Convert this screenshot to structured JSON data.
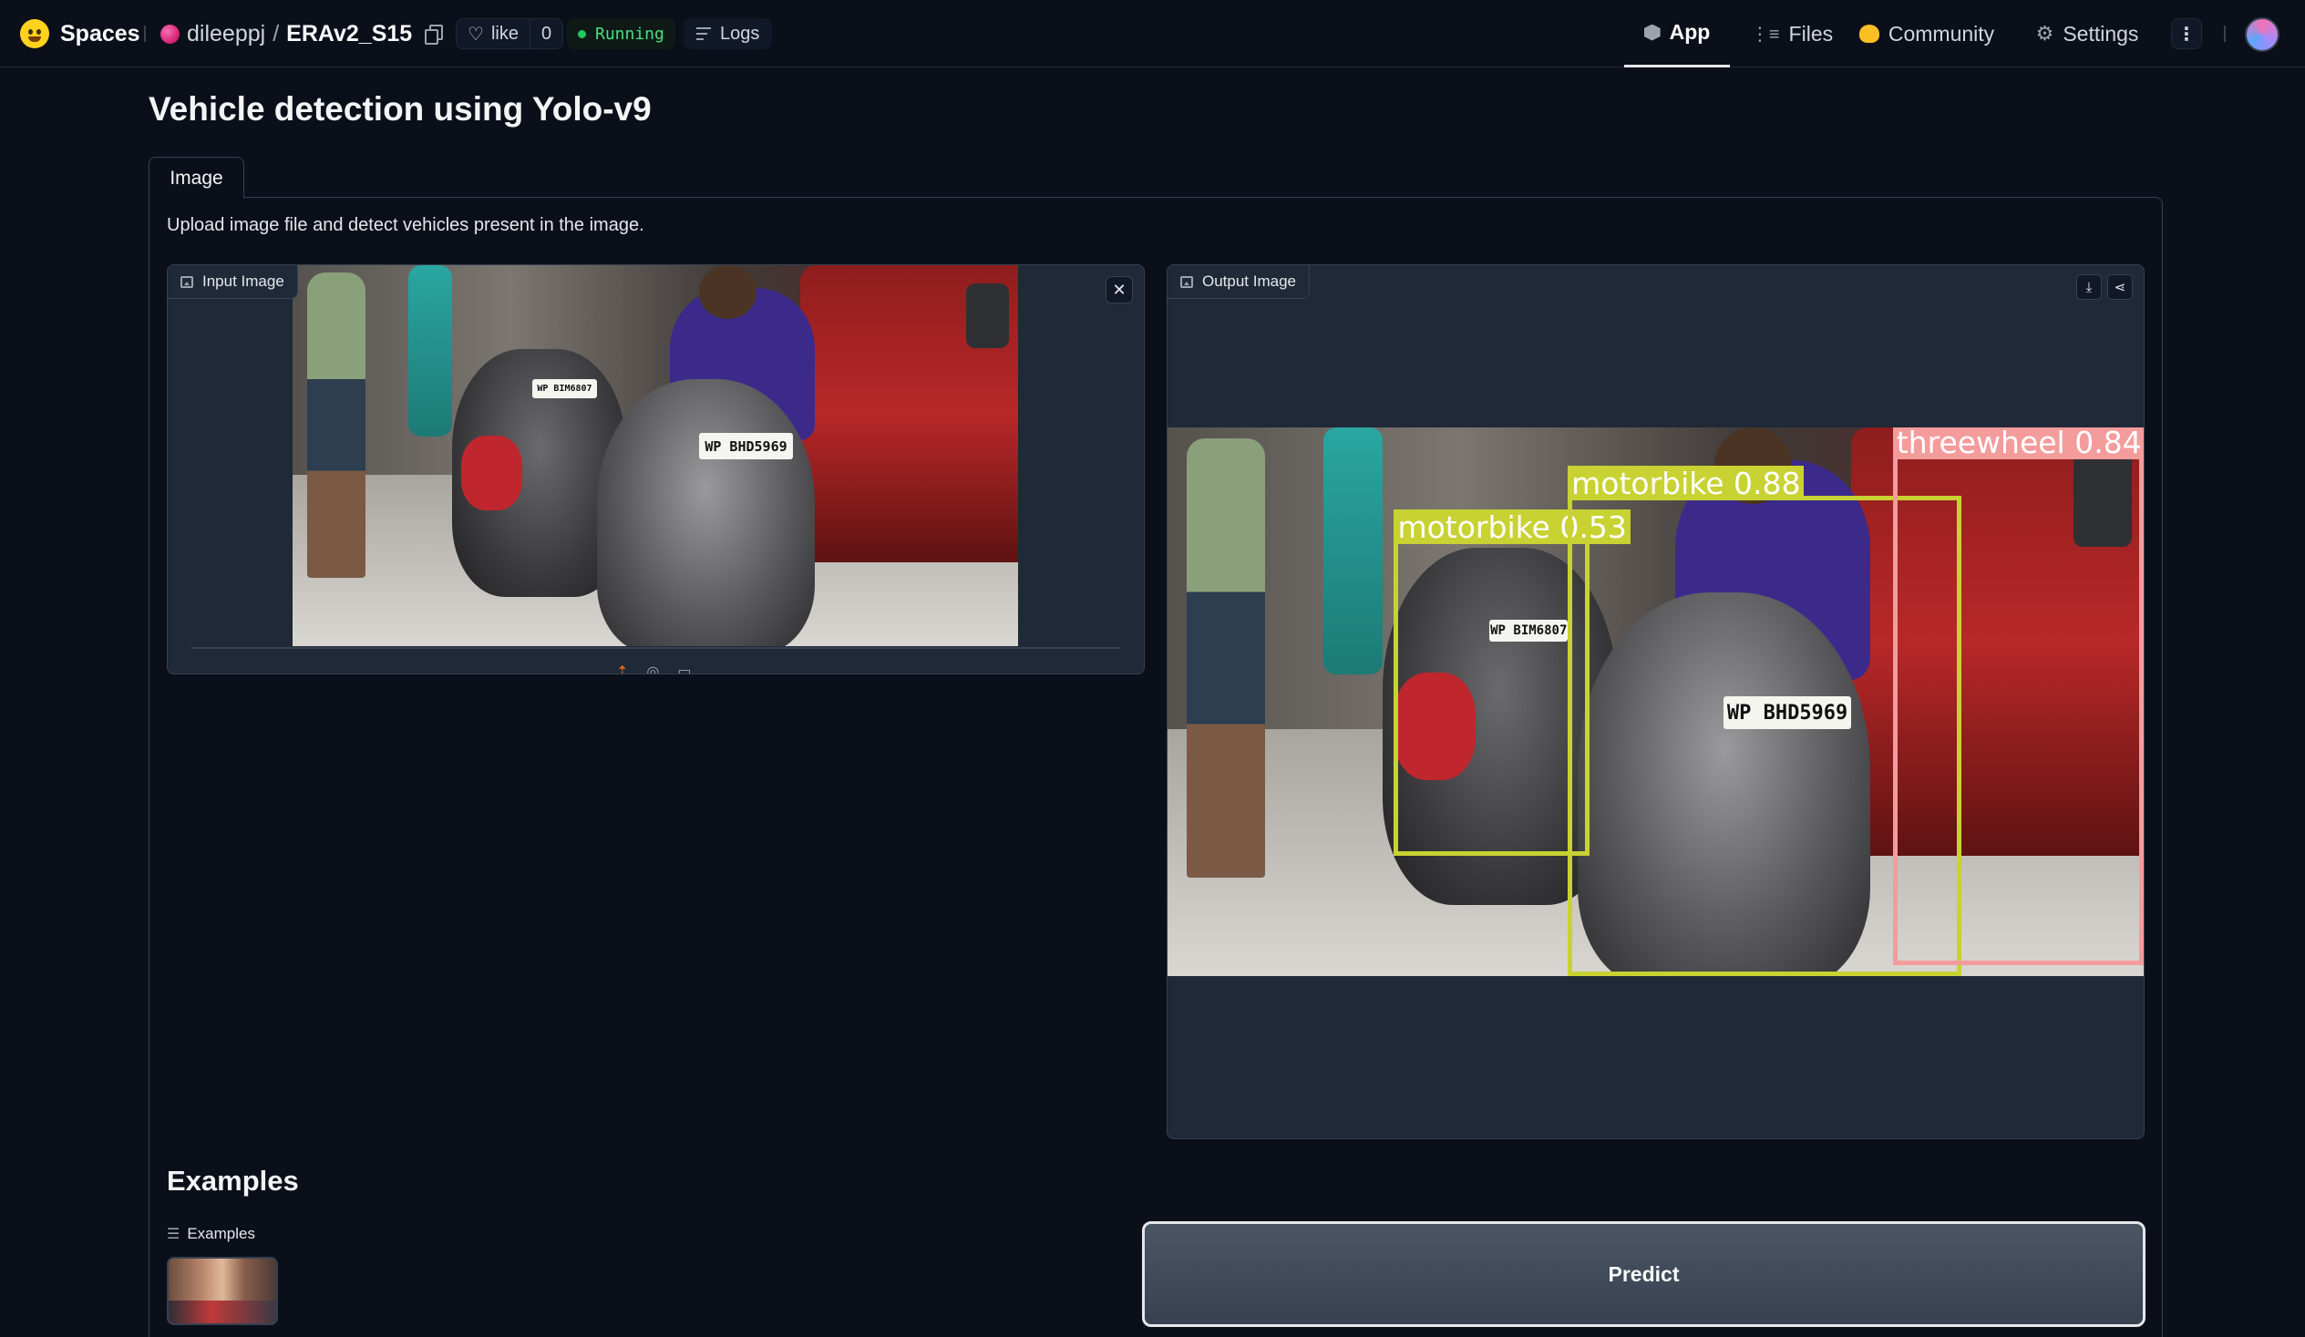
{
  "nav": {
    "brand": "Spaces",
    "owner": "dileeppj",
    "slash": "/",
    "space": "ERAv2_S15",
    "like_label": "like",
    "like_count": "0",
    "status": "Running",
    "logs": "Logs",
    "tabs": [
      "App",
      "Files",
      "Community",
      "Settings"
    ],
    "more": "⋮"
  },
  "app": {
    "title": "Vehicle detection using Yolo-v9",
    "tab": "Image",
    "description": "Upload image file and detect vehicles present in the image.",
    "input_label": "Input Image",
    "output_label": "Output Image",
    "input_plate": "WP BHD5969",
    "input_plate2": "WP BIM6807",
    "detections": [
      {
        "label": "motorbike",
        "score": "0.53",
        "text": "motorbike  0.53"
      },
      {
        "label": "motorbike",
        "score": "0.88",
        "text": "motorbike  0.88"
      },
      {
        "label": "threewheel",
        "score": "0.84",
        "text": "threewheel  0.84"
      }
    ],
    "examples_title": "Examples",
    "examples_label": "Examples",
    "predict": "Predict"
  },
  "colors": {
    "background": "#0b0f19",
    "block": "#1f2937",
    "motorbike_box": "#c8d232",
    "threewheel_box": "#f49b9b",
    "running": "#4ade80"
  },
  "icons": [
    "hugging-face-logo",
    "copy-icon",
    "heart-icon",
    "logs-icon",
    "cube-icon",
    "files-icon",
    "community-icon",
    "gear-icon",
    "more-icon",
    "image-icon",
    "close-icon",
    "download-icon",
    "share-icon",
    "upload-icon",
    "webcam-icon",
    "clipboard-icon",
    "list-icon"
  ]
}
